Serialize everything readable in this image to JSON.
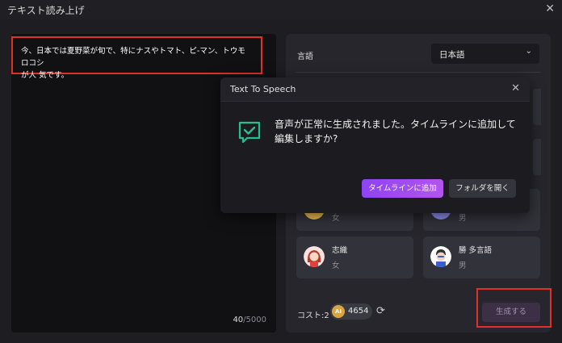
{
  "window": {
    "title": "テキスト読み上げ"
  },
  "editor": {
    "text_line1": "今、日本では夏野菜が旬で、特にナスやトマト、ピ-マン、トウモロコシ",
    "text_line2": "が人 気です。",
    "count_current": "40",
    "count_max": "/5000"
  },
  "panel": {
    "language_label": "言語",
    "language_value": "日本語",
    "voices": [
      {
        "name": "",
        "gender": "女"
      },
      {
        "name": "",
        "gender": "男"
      },
      {
        "name": "志織",
        "gender": "女"
      },
      {
        "name": "勝 多言語",
        "gender": "男"
      }
    ],
    "cost_label": "コスト:2",
    "credits": "4654",
    "generate_label": "生成する"
  },
  "dialog": {
    "title": "Text To Speech",
    "message": "音声が正常に生成されました。タイムラインに追加して編集しますか?",
    "primary_label": "タイムラインに追加",
    "secondary_label": "フォルダを開く"
  },
  "colors": {
    "accent": "#9a4ef2",
    "highlight": "#e0302b",
    "success": "#22c08a"
  }
}
